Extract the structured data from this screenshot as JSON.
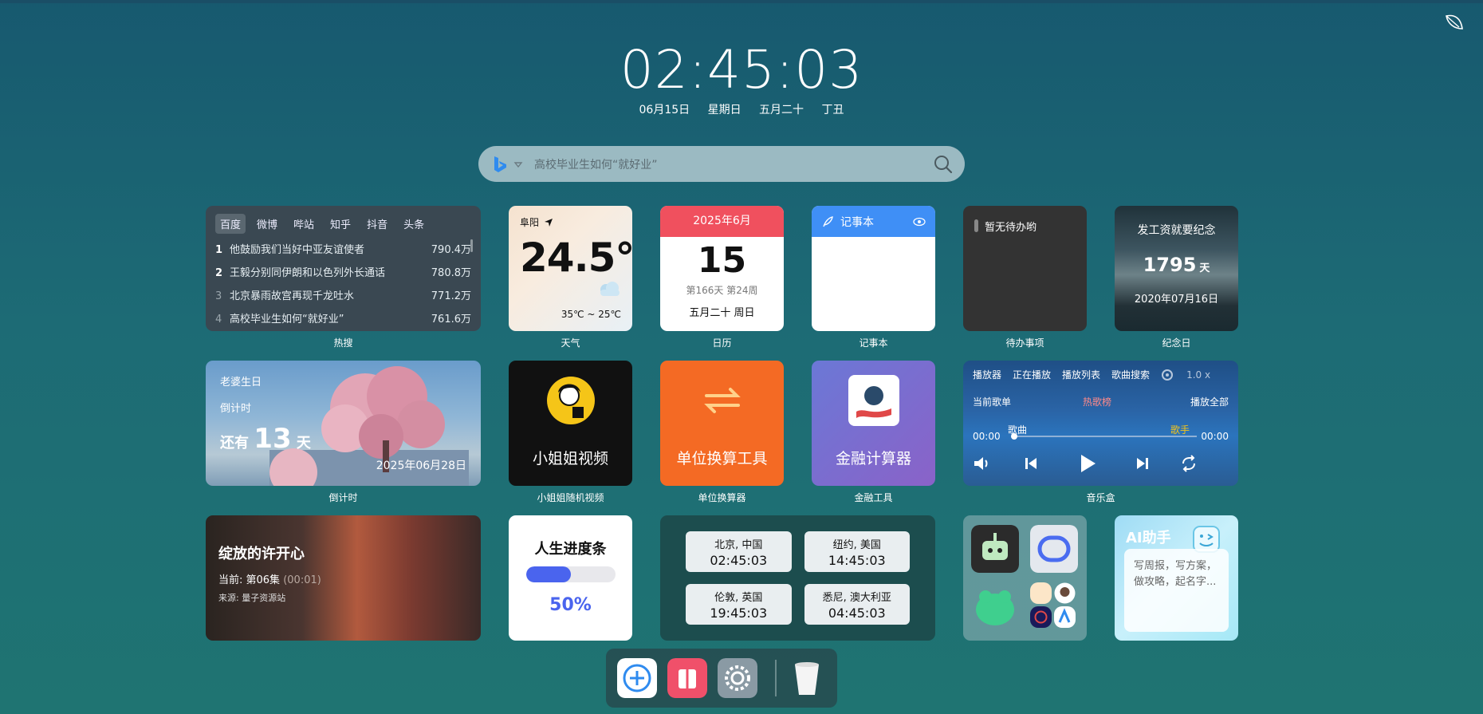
{
  "clock": {
    "time": "02:45:03"
  },
  "date": {
    "md": "06月15日",
    "weekday": "星期日",
    "lunar": "五月二十",
    "ganzhi": "丁丑"
  },
  "search": {
    "placeholder": "高校毕业生如何“就好业”",
    "engine_icon": "bing-icon"
  },
  "hot": {
    "label": "热搜",
    "tabs": [
      "百度",
      "微博",
      "哔站",
      "知乎",
      "抖音",
      "头条"
    ],
    "items": [
      {
        "rank": "1",
        "title": "他鼓励我们当好中亚友谊使者",
        "value": "790.4万"
      },
      {
        "rank": "2",
        "title": "王毅分别同伊朗和以色列外长通话",
        "value": "780.8万"
      },
      {
        "rank": "3",
        "title": "北京暴雨故宫再现千龙吐水",
        "value": "771.2万"
      },
      {
        "rank": "4",
        "title": "高校毕业生如何“就好业”",
        "value": "761.6万"
      }
    ]
  },
  "weather": {
    "label": "天气",
    "city": "阜阳",
    "temp": "24.5°",
    "range": "35℃ ~ 25℃"
  },
  "calendar": {
    "label": "日历",
    "month": "2025年6月",
    "day": "15",
    "info": "第166天 第24周",
    "lunar": "五月二十 周日"
  },
  "note": {
    "label": "记事本",
    "title": "记事本"
  },
  "todo": {
    "label": "待办事项",
    "empty": "暂无待办哟"
  },
  "anniv": {
    "label": "纪念日",
    "title": "发工资就要纪念",
    "days": "1795",
    "unit": "天",
    "date": "2020年07月16日"
  },
  "countdown": {
    "label": "倒计时",
    "name": "老婆生日",
    "type": "倒计时",
    "prefix": "还有",
    "days": "13",
    "unit": "天",
    "date": "2025年06月28日"
  },
  "apps": {
    "girl": {
      "title": "小姐姐视频",
      "label": "小姐姐随机视频"
    },
    "unit": {
      "title": "单位换算工具",
      "label": "单位换算器"
    },
    "fin": {
      "title": "金融计算器",
      "label": "金融工具"
    }
  },
  "music": {
    "label": "音乐盒",
    "menu": [
      "播放器",
      "正在播放",
      "播放列表",
      "歌曲搜索"
    ],
    "speed": "1.0 x",
    "current": "当前歌单",
    "playlist": "热歌榜",
    "play_all": "播放全部",
    "song": "歌曲",
    "singer": "歌手",
    "start": "00:00",
    "end": "00:00"
  },
  "drama": {
    "title": "绽放的许开心",
    "ep_prefix": "当前: 第06集",
    "ep_time": "(00:01)",
    "source": "来源: 量子资源站"
  },
  "life": {
    "title": "人生进度条",
    "percent_text": "50%",
    "progress": 0.5
  },
  "world": [
    {
      "city": "北京, 中国",
      "time": "02:45:03"
    },
    {
      "city": "纽约, 美国",
      "time": "14:45:03"
    },
    {
      "city": "伦敦, 英国",
      "time": "19:45:03"
    },
    {
      "city": "悉尼, 澳大利亚",
      "time": "04:45:03"
    }
  ],
  "ai": {
    "title": "AI助手",
    "hint": "写周报，写方案，做攻略，起名字..."
  },
  "colors": {
    "accent_blue": "#3f8ff6",
    "cal_red": "#f0505e",
    "life_blue": "#4a64ee",
    "unit_orange": "#f46a24"
  },
  "dock": {
    "icons": [
      "add-icon",
      "gift-icon",
      "settings-icon",
      "trash-icon"
    ]
  }
}
